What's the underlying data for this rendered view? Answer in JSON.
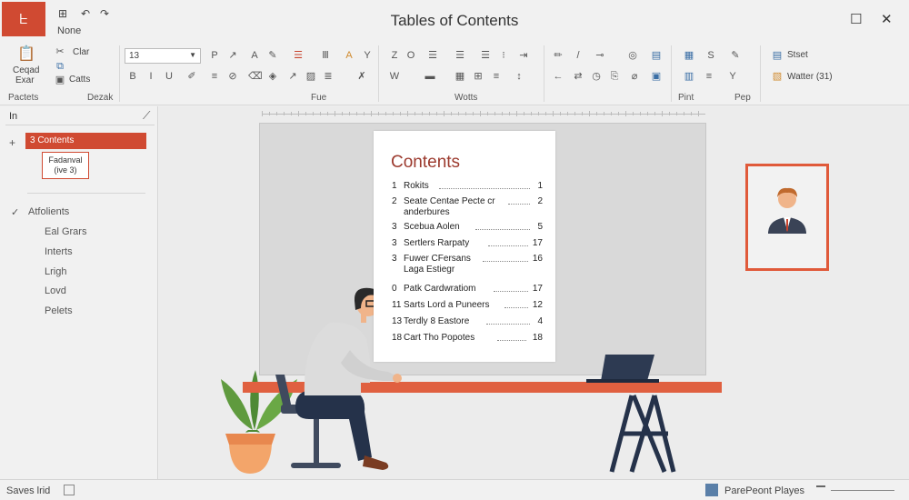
{
  "titlebar": {
    "app_icon_label": "ᖶ",
    "qa_label": "None",
    "title": "Tables of Contents"
  },
  "ribbon": {
    "clipboard_top": "Clar",
    "clipboard_bottom": "Catts",
    "paste_label_1": "Ceqad",
    "paste_label_2": "Exar",
    "font_box": "13",
    "style_top": "Stset",
    "style_bottom": "Watter (31)",
    "groups": [
      "Pactets",
      "Dezak",
      "Fue",
      "Wotts",
      "Pint",
      "Pep"
    ],
    "accent": "#d04a32"
  },
  "nav": {
    "header": "In",
    "selected": "3 Contents",
    "sub_line1": "Fadanval",
    "sub_line2": "(ive 3)",
    "section_title": "Atfolients",
    "items": [
      "Eal Grars",
      "Interts",
      "Lrigh",
      "Lovd",
      "Pelets"
    ]
  },
  "toc": {
    "heading": "Contents",
    "rows": [
      {
        "num": "1",
        "text": "Rokits",
        "page": "1"
      },
      {
        "num": "2",
        "text": "Seate Centae Pecte cr",
        "text2": "anderbures",
        "page": "2"
      },
      {
        "num": "3",
        "text": "Scebua Aolen",
        "page": "5"
      },
      {
        "num": "3",
        "text": "Sertlers Rarpaty",
        "page": "17"
      },
      {
        "num": "3",
        "text": "Fuwer CFersans",
        "text2": "Laga Estiegr",
        "page": "16"
      },
      {
        "num": "0",
        "text": "Patk Cardwratiom",
        "page": "17"
      },
      {
        "num": "11",
        "text": "Sarts Lord a Puneers",
        "page": "12"
      },
      {
        "num": "13",
        "text": "Terdly 8 Eastore",
        "page": "4"
      },
      {
        "num": "18",
        "text": "Cart Tho Popotes",
        "page": "18"
      }
    ]
  },
  "status": {
    "left": "Saves lrid",
    "player": "ParePeont Playes"
  },
  "colors": {
    "accent": "#d04a32",
    "frame": "#e05a3a",
    "desk": "#e06040",
    "navy": "#25324a"
  }
}
